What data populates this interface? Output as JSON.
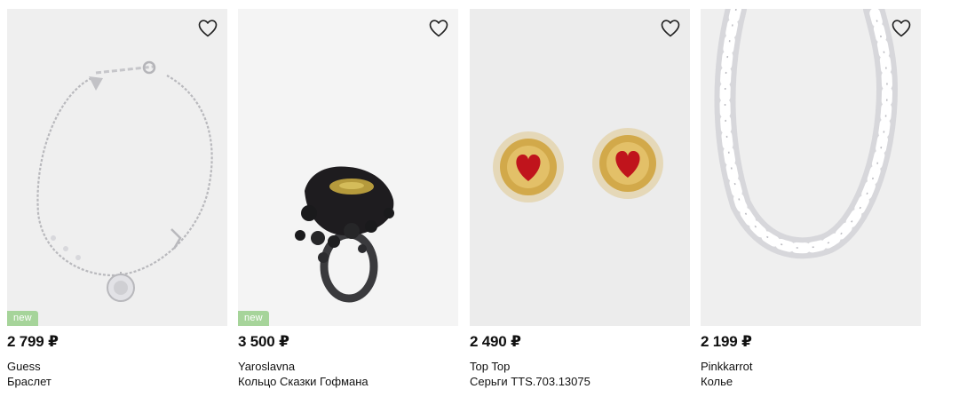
{
  "products": [
    {
      "price": "2 799 ₽",
      "brand": "Guess",
      "name": "Браслет",
      "badge": "new",
      "image_bg": "#efefef"
    },
    {
      "price": "3 500 ₽",
      "brand": "Yaroslavna",
      "name": "Кольцо Сказки Гофмана",
      "badge": "new",
      "image_bg": "#f4f4f4"
    },
    {
      "price": "2 490 ₽",
      "brand": "Top Top",
      "name": "Серьги TTS.703.13075",
      "image_bg": "#ececec"
    },
    {
      "price": "2 199 ₽",
      "brand": "Pinkkarrot",
      "name": "Колье",
      "image_bg": "#efefef"
    }
  ],
  "colors": {
    "badge_bg": "#a6d49a",
    "heart_stroke": "#222222"
  },
  "icons": {
    "favorite": "heart-outline-icon"
  }
}
